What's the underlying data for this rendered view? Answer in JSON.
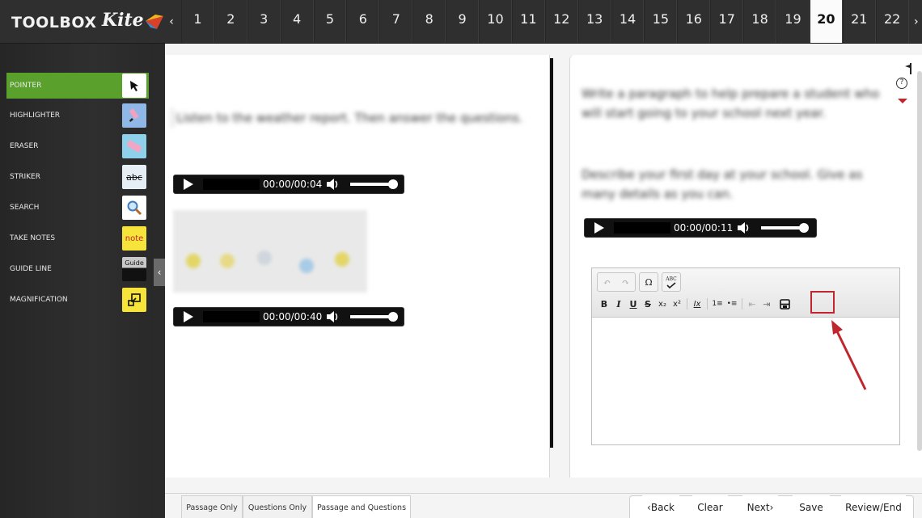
{
  "header": {
    "toolbox_title": "TOOLBOX",
    "logo_text": "Kite",
    "prev_arrow": "‹",
    "next_arrow": "›",
    "questions": [
      "1",
      "2",
      "3",
      "4",
      "5",
      "6",
      "7",
      "8",
      "9",
      "10",
      "11",
      "12",
      "13",
      "14",
      "15",
      "16",
      "17",
      "18",
      "19",
      "20",
      "21",
      "22"
    ],
    "active_question": "20"
  },
  "tools": [
    {
      "label": "POINTER",
      "icon": "pointer-arrow-icon",
      "active": true
    },
    {
      "label": "HIGHLIGHTER",
      "icon": "highlighter-icon"
    },
    {
      "label": "ERASER",
      "icon": "eraser-icon"
    },
    {
      "label": "STRIKER",
      "icon": "strikethrough-icon",
      "icon_text": "abc"
    },
    {
      "label": "SEARCH",
      "icon": "magnifier-icon"
    },
    {
      "label": "TAKE NOTES",
      "icon": "note-icon",
      "icon_text": "note"
    },
    {
      "label": "GUIDE LINE",
      "icon": "guide-line-icon",
      "icon_text": "Guide"
    },
    {
      "label": "MAGNIFICATION",
      "icon": "magnification-icon"
    }
  ],
  "sidebar_collapse_glyph": "‹",
  "passage": {
    "instructions": "Listen to the weather report. Then answer the questions.",
    "audio1_time": "00:00/00:04",
    "audio2_time": "00:00/00:40"
  },
  "question": {
    "paragraph1": "Write a paragraph to help prepare a student who will start going to your school next year.",
    "paragraph2": "Describe your first day at your school. Give as many details as you can.",
    "audio_time": "00:00/00:11",
    "help_glyph": "?"
  },
  "editor": {
    "undo": "↶",
    "redo": "↷",
    "special_char": "Ω",
    "spellcheck": "ABC",
    "format_buttons": [
      "B",
      "I",
      "U",
      "S",
      "x₂",
      "x²",
      "Ix",
      "1≡",
      "•≡",
      "⇤",
      "⇥"
    ]
  },
  "bottom": {
    "view_tabs": [
      "Passage Only",
      "Questions Only",
      "Passage and Questions"
    ],
    "active_view": "Passage and Questions",
    "back": "‹Back",
    "clear": "Clear",
    "next": "Next›",
    "save": "Save",
    "review": "Review/End"
  },
  "colors": {
    "active_tool": "#5aa02c",
    "highlight_box": "#c0262e",
    "annotation_arrow": "#c0262e"
  }
}
